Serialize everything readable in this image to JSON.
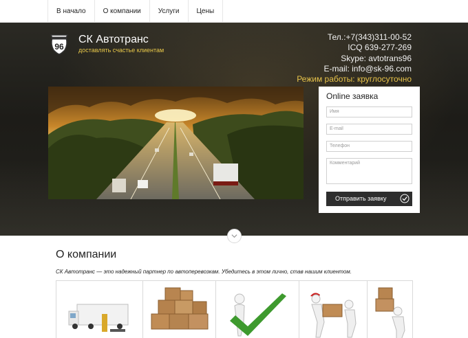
{
  "nav": {
    "items": [
      "В начало",
      "О компании",
      "Услуги",
      "Цены"
    ]
  },
  "header": {
    "logo_text": "96",
    "brand_name": "СК Автотранс",
    "tagline": "доставлять счастье клиентам"
  },
  "contacts": {
    "phone": "Тел.:+7(343)311-00-52",
    "icq": "ICQ 639-277-269",
    "skype": "Skype: avtotrans96",
    "email": "E-mail: info@sk-96.com",
    "hours": "Режим работы: круглосуточно"
  },
  "form": {
    "title": "Online заявка",
    "name_placeholder": "Имя",
    "email_placeholder": "E-mail",
    "phone_placeholder": "Телефон",
    "comment_placeholder": "Комментарий",
    "submit_label": "Отправить заявку"
  },
  "about": {
    "title": "О компании",
    "text": "СК Автотранс — это надежный партнер по автоперевозкам. Убедитесь в этом лично, став нашим клиентом."
  },
  "colors": {
    "accent": "#e7c34a",
    "dark_button": "#2e2e2e"
  },
  "icons": [
    "route-96-logo-icon",
    "chevron-down-icon",
    "check-circle-icon"
  ]
}
